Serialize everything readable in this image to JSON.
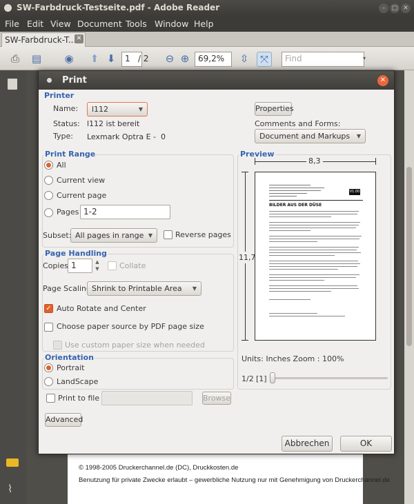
{
  "window": {
    "title": "SW-Farbdruck-Testseite.pdf - Adobe Reader"
  },
  "menubar": [
    "File",
    "Edit",
    "View",
    "Document",
    "Tools",
    "Window",
    "Help"
  ],
  "tab": {
    "label": "SW-Farbdruck-T..."
  },
  "toolbar": {
    "page_current": "1",
    "page_total": "/ 2",
    "zoom": "69,2%",
    "find_placeholder": "Find"
  },
  "document": {
    "footer_line1": "© 1998-2005 Druckerchannel.de (DC), Druckkosten.de",
    "footer_line2": "Benutzung für private Zwecke erlaubt – gewerbliche Nutzung nur mit Genehmigung von Druckerchannel.de"
  },
  "dialog": {
    "title": "Print",
    "printer": {
      "section": "Printer",
      "name_label": "Name:",
      "name_value": "l112",
      "status_label": "Status:",
      "status_value": "l112 ist bereit",
      "type_label": "Type:",
      "type_value": "Lexmark Optra E -  0",
      "properties": "Properties",
      "comments_label": "Comments and Forms:",
      "comments_value": "Document and Markups"
    },
    "range": {
      "section": "Print Range",
      "all": "All",
      "current_view": "Current view",
      "current_page": "Current page",
      "pages": "Pages",
      "pages_value": "1-2",
      "subset_label": "Subset:",
      "subset_value": "All pages in range",
      "reverse": "Reverse pages"
    },
    "handling": {
      "section": "Page Handling",
      "copies_label": "Copies",
      "copies_value": "1",
      "collate": "Collate",
      "scaling_label": "Page Scaling",
      "scaling_value": "Shrink to Printable Area",
      "auto_rotate": "Auto Rotate and Center",
      "paper_source": "Choose paper source by PDF page size",
      "custom_paper": "Use custom paper size when needed"
    },
    "orientation": {
      "section": "Orientation",
      "portrait": "Portrait",
      "landscape": "LandScape"
    },
    "print_to_file": "Print to file",
    "browse": "Browse",
    "advanced": "Advanced",
    "preview": {
      "section": "Preview",
      "width": "8,3",
      "height": "11,7",
      "units": "Units: Inches Zoom : 100%",
      "page_indicator": "1/2",
      "page_box": "[1]",
      "page_heading": "BILDER AUS DER DÜSE",
      "page_badge": "V1.00"
    },
    "cancel": "Abbrechen",
    "ok": "OK"
  }
}
